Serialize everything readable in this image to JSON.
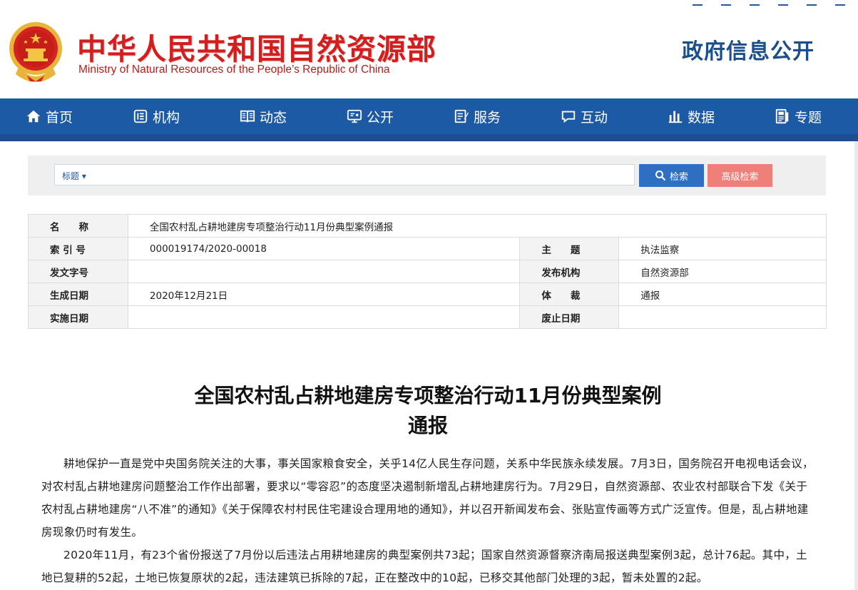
{
  "header": {
    "title": "中华人民共和国自然资源部",
    "subtitle": "Ministry of Natural Resources of the People’s Republic of China",
    "section": "政府信息公开"
  },
  "nav": {
    "items": [
      {
        "label": "首页",
        "icon": "home-icon"
      },
      {
        "label": "机构",
        "icon": "org-icon"
      },
      {
        "label": "动态",
        "icon": "book-icon"
      },
      {
        "label": "公开",
        "icon": "monitor-icon"
      },
      {
        "label": "服务",
        "icon": "form-icon"
      },
      {
        "label": "互动",
        "icon": "chat-icon"
      },
      {
        "label": "数据",
        "icon": "chart-icon"
      },
      {
        "label": "专题",
        "icon": "document-icon"
      }
    ]
  },
  "search": {
    "field": "标题",
    "value": "",
    "search_label": "检索",
    "advanced_label": "高级检索"
  },
  "meta": {
    "name_key": "名　　称",
    "name_val": "全国农村乱占耕地建房专项整治行动11月份典型案例通报",
    "index_key": "索 引 号",
    "index_val": "000019174/2020-00018",
    "topic_key": "主　　题",
    "topic_val": "执法监察",
    "docno_key": "发文字号",
    "docno_val": "",
    "issuer_key": "发布机构",
    "issuer_val": "自然资源部",
    "created_key": "生成日期",
    "created_val": "2020年12月21日",
    "genre_key": "体　　裁",
    "genre_val": "通报",
    "effective_key": "实施日期",
    "effective_val": "",
    "repeal_key": "废止日期",
    "repeal_val": ""
  },
  "article": {
    "title_line1": "全国农村乱占耕地建房专项整治行动11月份典型案例",
    "title_line2": "通报",
    "p1": "耕地保护一直是党中央国务院关注的大事，事关国家粮食安全，关乎14亿人民生存问题，关系中华民族永续发展。7月3日，国务院召开电视电话会议，对农村乱占耕地建房问题整治工作作出部署，要求以“零容忍”的态度坚决遏制新增乱占耕地建房行为。7月29日，自然资源部、农业农村部联合下发《关于农村乱占耕地建房“八不准”的通知》《关于保障农村村民住宅建设合理用地的通知》，并以召开新闻发布会、张贴宣传画等方式广泛宣传。但是，乱占耕地建房现象仍时有发生。",
    "p2": "2020年11月，有23个省份报送了7月份以后违法占用耕地建房的典型案例共73起；国家自然资源督察济南局报送典型案例3起，总计76起。其中，土地已复耕的52起，土地已恢复原状的2起，违法建筑已拆除的7起，正在整改中的10起，已移交其他部门处理的3起，暂未处置的2起。"
  },
  "colors": {
    "brand_red": "#d11f1f",
    "nav_blue": "#1d5aa6",
    "search_blue": "#2f6fc3",
    "advanced_red": "#ee7f79"
  }
}
